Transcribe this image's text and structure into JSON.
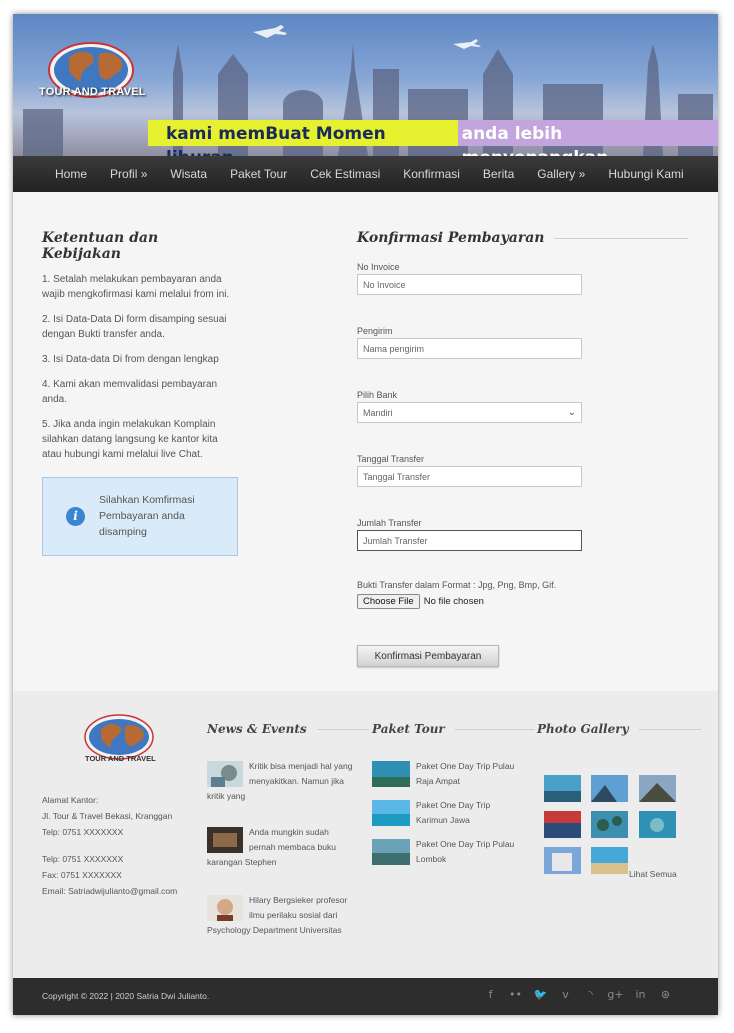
{
  "header": {
    "logo_text": "TOUR AND TRAVEL",
    "tagline_part1": "kami memBuat Momen liburan",
    "tagline_part2": "anda lebih menyenangkan"
  },
  "nav": {
    "items": [
      "Home",
      "Profil »",
      "Wisata",
      "Paket Tour",
      "Cek Estimasi",
      "Konfirmasi",
      "Berita",
      "Gallery »",
      "Hubungi Kami"
    ]
  },
  "policy": {
    "title": "Ketentuan dan Kebijakan",
    "rules": [
      "1. Setalah melakukan pembayaran anda wajib mengkofirmasi kami melalui from ini.",
      "2. Isi Data-Data Di form disamping sesuai dengan Bukti transfer anda.",
      "3. Isi Data-data Di from dengan lengkap",
      "4. Kami akan memvalidasi pembayaran anda.",
      "5. Jika anda ingin melakukan Komplain silahkan datang langsung ke kantor kita atau hubungi kami melalui live Chat."
    ],
    "info_text": "Silahkan Komfirmasi Pembayaran anda disamping"
  },
  "form": {
    "title": "Konfirmasi Pembayaran",
    "invoice": {
      "label": "No Invoice",
      "placeholder": "No Invoice"
    },
    "sender": {
      "label": "Pengirim",
      "placeholder": "Nama pengirim"
    },
    "bank": {
      "label": "Pilih Bank",
      "value": "Mandiri"
    },
    "date": {
      "label": "Tanggal Transfer",
      "placeholder": "Tanggal Transfer"
    },
    "amount": {
      "label": "Jumlah Transfer",
      "placeholder": "Jumlah Transfer"
    },
    "proof": {
      "label": "Bukti Transfer dalam Format : Jpg, Png, Bmp, Gif.",
      "button": "Choose File",
      "status": "No file chosen"
    },
    "submit_label": "Konfirmasi Pembayaran"
  },
  "footer": {
    "logo_text": "TOUR AND TRAVEL",
    "address": {
      "heading": "Alamat Kantor:",
      "line1": "Jl. Tour & Travel Bekasi, Kranggan",
      "phone1": "Telp: 0751 XXXXXXX",
      "phone2": "Telp: 0751 XXXXXXX",
      "fax": "Fax: 0751 XXXXXXX",
      "email": "Email: Satriadwijulianto@gmail.com"
    },
    "news": {
      "title": "News & Events",
      "items": [
        "Kritik bisa menjadi hal yang menyakitkan. Namun jika kritik yang",
        "Anda mungkin sudah pernah membaca buku karangan Stephen",
        "Hilary Bergsieker profesor ilmu perilaku sosial dari Psychology Department Universitas"
      ]
    },
    "packages": {
      "title": "Paket Tour",
      "items": [
        "Paket One Day Trip Pulau Raja Ampat",
        "Paket One Day Trip Karimun Jawa",
        "Paket One Day Trip Pulau Lombok"
      ]
    },
    "gallery": {
      "title": "Photo Gallery",
      "see_all": "Lihat Semua"
    }
  },
  "bottom": {
    "copyright": "Copyright © 2022 | 2020 Satria Dwi Julianto.",
    "social_icons": [
      "facebook-icon",
      "flickr-icon",
      "twitter-icon",
      "vimeo-icon",
      "rss-icon",
      "google-plus-icon",
      "linkedin-icon",
      "dribbble-icon"
    ],
    "social_glyphs": [
      "f",
      "••",
      "🐦",
      "v",
      "◝",
      "g+",
      "in",
      "⊛"
    ]
  },
  "colors": {
    "nav_bg": "#2a2a2a",
    "tag_yellow": "#e5f02f",
    "tag_purple": "#c2a5dc",
    "info_bg": "#d9eaf8",
    "info_icon": "#3b84d4"
  }
}
